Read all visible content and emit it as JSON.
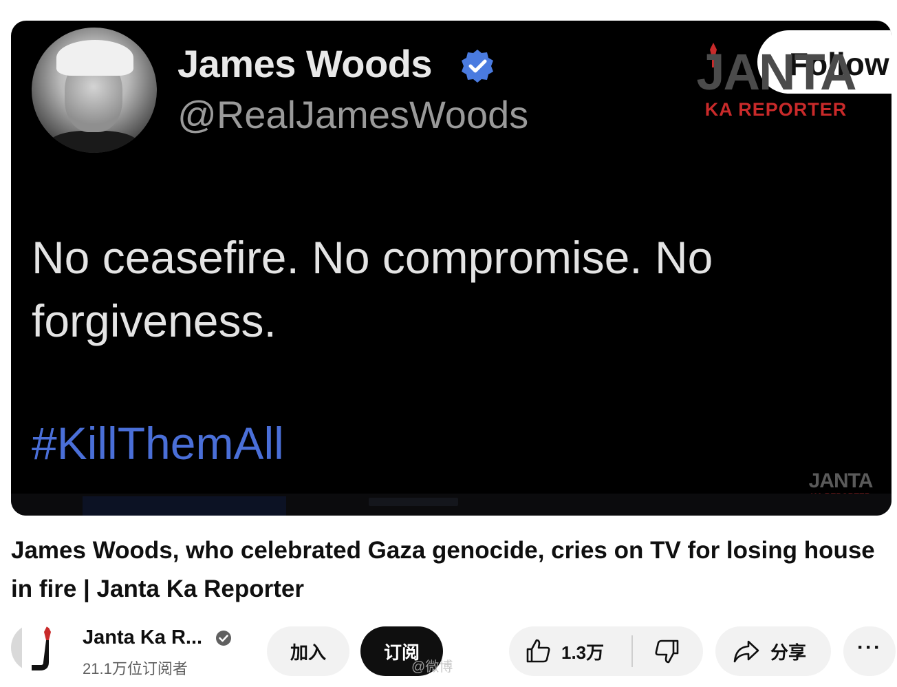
{
  "thumbnail": {
    "tweet_author_name": "James Woods",
    "tweet_author_handle": "@RealJamesWoods",
    "tweet_text": "No ceasefire. No compromise. No forgiveness.",
    "tweet_hashtag": "#KillThemAll",
    "follow_label": "Follow",
    "watermark_brand": "JANTA",
    "watermark_sub": "KA REPORTER",
    "colors": {
      "hashtag": "#4a6fd8",
      "verified": "#4a7be0",
      "watermark_red": "#c92a2a"
    }
  },
  "video": {
    "title": "James Woods, who celebrated Gaza genocide, cries on TV for losing house in fire | Janta Ka Reporter"
  },
  "channel": {
    "name": "Janta Ka R...",
    "subscribers": "21.1万位订阅者"
  },
  "actions": {
    "join_label": "加入",
    "subscribe_label": "订阅",
    "like_count": "1.3万",
    "share_label": "分享",
    "more_label": "···"
  },
  "overlay": {
    "weibo_watermark": "@微博"
  },
  "icons": [
    "verified-icon",
    "pen-icon",
    "like-icon",
    "dislike-icon",
    "share-icon",
    "more-icon"
  ]
}
